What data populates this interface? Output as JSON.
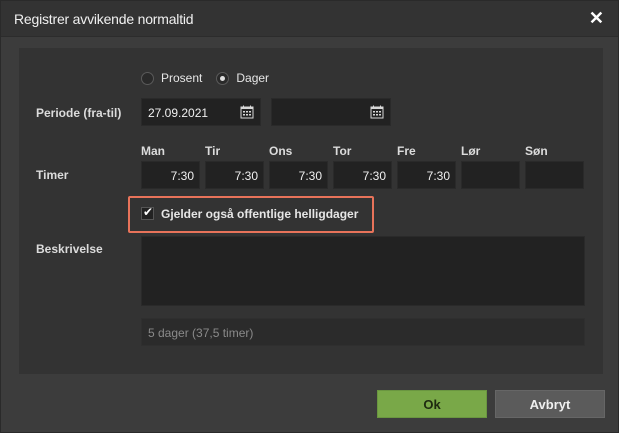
{
  "dialog": {
    "title": "Registrer avvikende normaltid",
    "close_symbol": "✕"
  },
  "mode": {
    "options": [
      {
        "label": "Prosent",
        "selected": false
      },
      {
        "label": "Dager",
        "selected": true
      }
    ]
  },
  "period": {
    "label": "Periode (fra-til)",
    "from_value": "27.09.2021",
    "to_value": "",
    "calendar_icon": "calendar-icon"
  },
  "hours": {
    "label": "Timer",
    "days": [
      {
        "name": "Man",
        "value": "7:30"
      },
      {
        "name": "Tir",
        "value": "7:30"
      },
      {
        "name": "Ons",
        "value": "7:30"
      },
      {
        "name": "Tor",
        "value": "7:30"
      },
      {
        "name": "Fre",
        "value": "7:30"
      },
      {
        "name": "Lør",
        "value": ""
      },
      {
        "name": "Søn",
        "value": ""
      }
    ]
  },
  "holiday": {
    "label": "Gjelder også offentlige helligdager",
    "checked": true,
    "highlight_color": "#e8735a"
  },
  "description": {
    "label": "Beskrivelse",
    "value": ""
  },
  "summary": {
    "text": "5 dager (37,5 timer)"
  },
  "buttons": {
    "ok": "Ok",
    "cancel": "Avbryt"
  },
  "colors": {
    "ok_bg": "#79a848",
    "cancel_bg": "#5b5b5b",
    "panel_bg": "#333333",
    "input_bg": "#222222"
  }
}
